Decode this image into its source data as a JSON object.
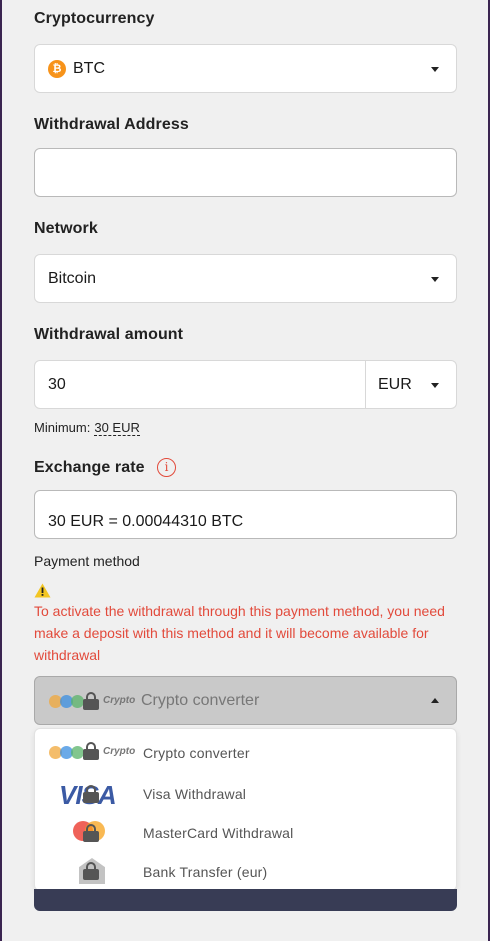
{
  "form": {
    "crypto": {
      "label": "Cryptocurrency",
      "icon": "bitcoin-icon",
      "icon_glyph": "₿",
      "value": "BTC"
    },
    "address": {
      "label": "Withdrawal Address",
      "value": ""
    },
    "network": {
      "label": "Network",
      "value": "Bitcoin"
    },
    "amount": {
      "label": "Withdrawal amount",
      "value": "30",
      "currency": "EUR"
    },
    "minimum": {
      "label": "Minimum:",
      "value": "30 EUR"
    },
    "rate": {
      "label": "Exchange rate",
      "info_glyph": "i",
      "value": "30 EUR = 0.00044310 BTC"
    },
    "payment": {
      "label": "Payment method",
      "warning": "To activate the withdrawal through this payment method, you need make a deposit with this method and it will become available for withdrawal",
      "selected": "Crypto converter",
      "options": [
        {
          "label": "Crypto converter",
          "icon": "crypto-logo"
        },
        {
          "label": "Visa Withdrawal",
          "icon": "visa-logo"
        },
        {
          "label": "MasterCard Withdrawal",
          "icon": "mastercard-logo"
        },
        {
          "label": "Bank Transfer (eur)",
          "icon": "bank-logo"
        }
      ]
    }
  },
  "logos": {
    "crypto_text": "Crypto",
    "visa_text": "VISA"
  },
  "colors": {
    "accent_error": "#e24a3b",
    "bitcoin": "#f7931a",
    "footer_button": "#383c55"
  }
}
